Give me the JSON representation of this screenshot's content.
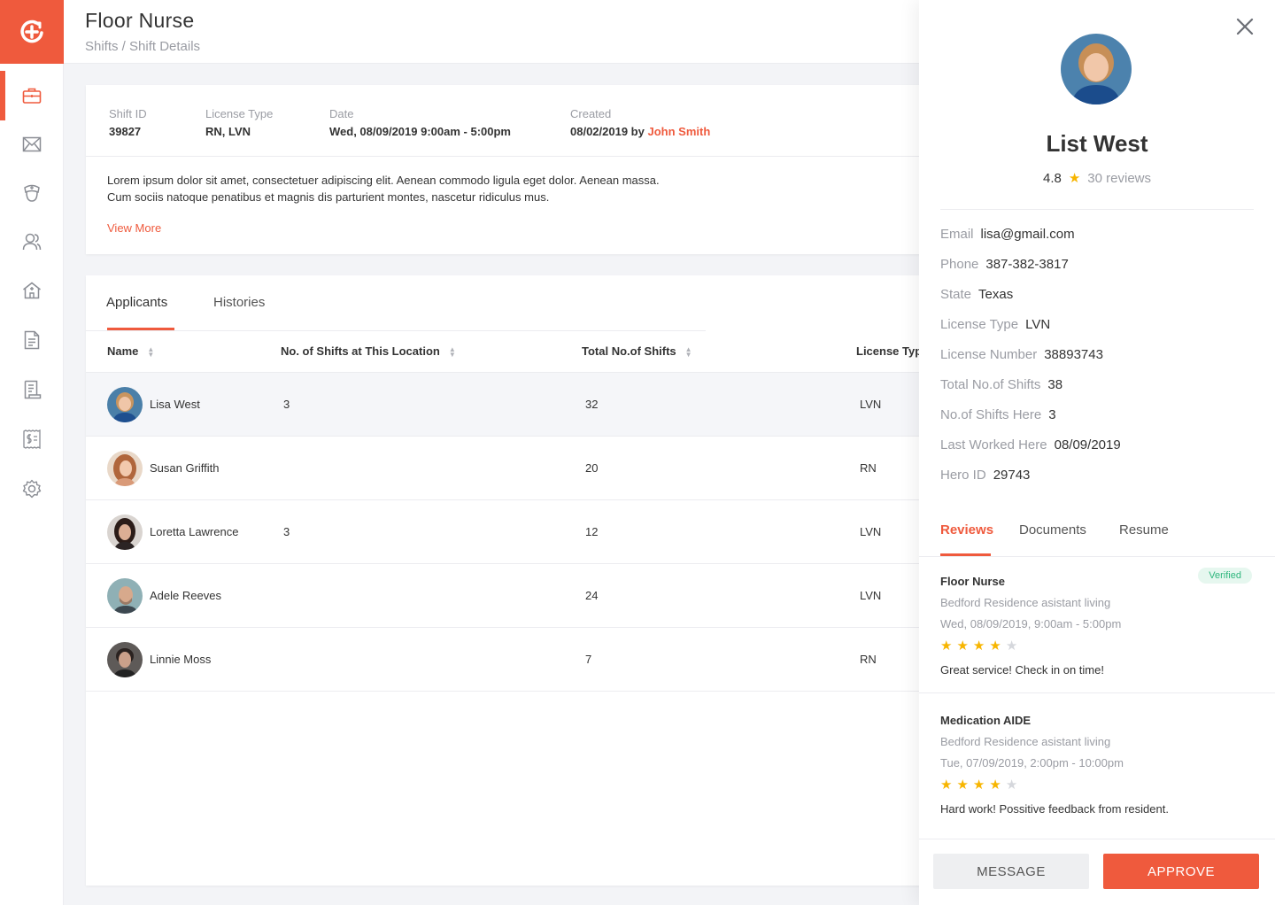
{
  "header": {
    "title": "Floor Nurse",
    "breadcrumb": "Shifts / Shift Details"
  },
  "sidebar": {
    "items": [
      {
        "icon": "briefcase-icon",
        "active": true
      },
      {
        "icon": "mail-icon"
      },
      {
        "icon": "nurse-cap-icon"
      },
      {
        "icon": "users-icon"
      },
      {
        "icon": "facility-icon"
      },
      {
        "icon": "document-icon"
      },
      {
        "icon": "invoice-icon"
      },
      {
        "icon": "payroll-icon"
      },
      {
        "icon": "gear-icon"
      }
    ]
  },
  "shift": {
    "id_label": "Shift ID",
    "id_value": "39827",
    "license_label": "License Type",
    "license_value": "RN, LVN",
    "date_label": "Date",
    "date_value": "Wed, 08/09/2019 9:00am - 5:00pm",
    "created_label": "Created",
    "created_value": "08/02/2019 by",
    "created_by": "John Smith",
    "description": "Lorem ipsum dolor sit amet, consectetuer adipiscing elit. Aenean commodo ligula eget dolor. Aenean massa. Cum sociis natoque penatibus et magnis dis parturient montes, nascetur ridiculus mus.",
    "view_more": "View More"
  },
  "tabs": {
    "applicants": "Applicants",
    "histories": "Histories"
  },
  "table": {
    "headers": {
      "name": "Name",
      "shifts_here": "No. of Shifts at This Location",
      "total_shifts": "Total No.of Shifts",
      "license": "License Type"
    },
    "rows": [
      {
        "name": "Lisa West",
        "shifts_here": "3",
        "total": "32",
        "license": "LVN"
      },
      {
        "name": "Susan Griffith",
        "shifts_here": "",
        "total": "20",
        "license": "RN"
      },
      {
        "name": "Loretta Lawrence",
        "shifts_here": "3",
        "total": "12",
        "license": "LVN"
      },
      {
        "name": "Adele Reeves",
        "shifts_here": "",
        "total": "24",
        "license": "LVN"
      },
      {
        "name": "Linnie Moss",
        "shifts_here": "",
        "total": "7",
        "license": "RN"
      }
    ]
  },
  "panel": {
    "name": "List West",
    "rating": "4.8",
    "reviews_count": "30 reviews",
    "details": {
      "email_label": "Email",
      "email": "lisa@gmail.com",
      "phone_label": "Phone",
      "phone": "387-382-3817",
      "state_label": "State",
      "state": "Texas",
      "license_label": "License Type",
      "license": "LVN",
      "license_number_label": "License Number",
      "license_number": "38893743",
      "total_shifts_label": "Total No.of Shifts",
      "total_shifts": "38",
      "shifts_here_label": "No.of Shifts Here",
      "shifts_here": "3",
      "last_worked_label": "Last Worked Here",
      "last_worked": "08/09/2019",
      "hero_id_label": "Hero ID",
      "hero_id": "29743"
    },
    "tabs": {
      "reviews": "Reviews",
      "documents": "Documents",
      "resume": "Resume"
    },
    "reviews": [
      {
        "title": "Floor Nurse",
        "place": "Bedford Residence asistant living",
        "date": "Wed, 08/09/2019, 9:00am - 5:00pm",
        "stars": 4,
        "text": "Great service! Check in on time!",
        "badge": "Verified"
      },
      {
        "title": "Medication AIDE",
        "place": "Bedford Residence asistant living",
        "date": "Tue, 07/09/2019, 2:00pm - 10:00pm",
        "stars": 4,
        "text": "Hard work! Possitive feedback from resident."
      }
    ],
    "message_label": "MESSAGE",
    "approve_label": "APPROVE"
  },
  "colors": {
    "accent": "#ef5a3d",
    "star": "#f7b500",
    "verified": "#2eb67d"
  }
}
